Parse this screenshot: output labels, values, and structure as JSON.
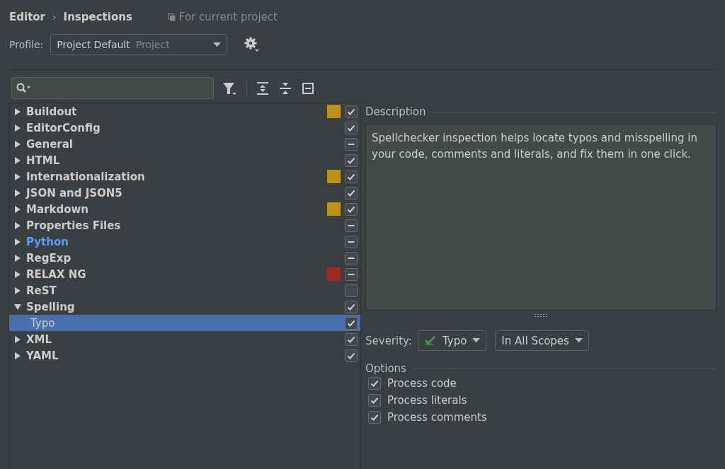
{
  "breadcrumb": {
    "items": [
      "Editor",
      "Inspections"
    ],
    "separator": "›",
    "scope_note": "For current project"
  },
  "profile": {
    "label": "Profile:",
    "value": "Project Default",
    "hint": "Project"
  },
  "tree": [
    {
      "label": "Buildout",
      "expanded": false,
      "checked": true,
      "partial": false,
      "modified": false,
      "selected": false,
      "color": "#be9117"
    },
    {
      "label": "EditorConfig",
      "expanded": false,
      "checked": true,
      "partial": false,
      "modified": false,
      "selected": false
    },
    {
      "label": "General",
      "expanded": false,
      "partial": true,
      "modified": false,
      "selected": false
    },
    {
      "label": "HTML",
      "expanded": false,
      "checked": true,
      "partial": false,
      "modified": false,
      "selected": false
    },
    {
      "label": "Internationalization",
      "expanded": false,
      "checked": true,
      "partial": false,
      "modified": false,
      "selected": false,
      "color": "#be9117"
    },
    {
      "label": "JSON and JSON5",
      "expanded": false,
      "checked": true,
      "partial": false,
      "modified": false,
      "selected": false
    },
    {
      "label": "Markdown",
      "expanded": false,
      "checked": true,
      "partial": false,
      "modified": false,
      "selected": false,
      "color": "#be9117"
    },
    {
      "label": "Properties Files",
      "expanded": false,
      "partial": true,
      "modified": false,
      "selected": false
    },
    {
      "label": "Python",
      "expanded": false,
      "partial": true,
      "modified": true,
      "selected": false
    },
    {
      "label": "RegExp",
      "expanded": false,
      "partial": true,
      "modified": false,
      "selected": false
    },
    {
      "label": "RELAX NG",
      "expanded": false,
      "partial": true,
      "modified": false,
      "selected": false,
      "color": "#9e2927"
    },
    {
      "label": "ReST",
      "expanded": false,
      "checked": false,
      "partial": false,
      "modified": false,
      "selected": false
    },
    {
      "label": "Spelling",
      "expanded": true,
      "checked": true,
      "partial": false,
      "modified": false,
      "selected": false,
      "children": [
        {
          "label": "Typo",
          "checked": true,
          "partial": false,
          "modified": false,
          "selected": true
        }
      ]
    },
    {
      "label": "XML",
      "expanded": false,
      "checked": true,
      "partial": false,
      "modified": false,
      "selected": false
    },
    {
      "label": "YAML",
      "expanded": false,
      "checked": true,
      "partial": false,
      "modified": false,
      "selected": false
    }
  ],
  "description": {
    "title": "Description",
    "text": "Spellchecker inspection helps locate typos and misspelling in your code, comments and literals, and fix them in one click."
  },
  "severity": {
    "label": "Severity:",
    "value": "Typo",
    "scope": "In All Scopes"
  },
  "options": {
    "title": "Options",
    "items": [
      {
        "label": "Process code",
        "checked": true
      },
      {
        "label": "Process literals",
        "checked": true
      },
      {
        "label": "Process comments",
        "checked": true
      }
    ]
  }
}
